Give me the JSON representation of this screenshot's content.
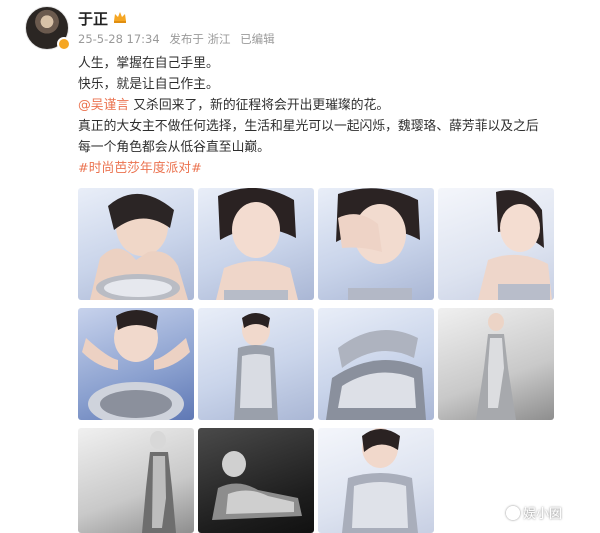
{
  "post": {
    "username": "于正",
    "badge_icon": "crown-icon",
    "verified_icon": "verified-badge-icon",
    "timestamp": "25-5-28 17:34",
    "source": "发布于 浙江",
    "edited": "已编辑",
    "lines": [
      "人生，掌握在自己手里。",
      "快乐，就是让自己作主。"
    ],
    "mention": "@吴谨言",
    "mention_tail": " 又杀回来了，新的征程将会开出更璀璨的花。",
    "line4": "真正的大女主不做任何选择，生活和星光可以一起闪烁，魏璎珞、薛芳菲以及之后",
    "line5": "每一个角色都会从低谷直至山巅。",
    "hashtag": "#时尚芭莎年度派对#"
  },
  "images": [
    {
      "name": "photo-1",
      "theme": "portrait hands on cheek, sequin dress"
    },
    {
      "name": "photo-2",
      "theme": "portrait chin on hand"
    },
    {
      "name": "photo-3",
      "theme": "portrait hand over face"
    },
    {
      "name": "photo-4",
      "theme": "portrait looking sideways"
    },
    {
      "name": "photo-5",
      "theme": "arms framing face"
    },
    {
      "name": "photo-6",
      "theme": "sequin dress pose"
    },
    {
      "name": "photo-7",
      "theme": "reclining in sequin dress"
    },
    {
      "name": "photo-8",
      "theme": "full length gown"
    },
    {
      "name": "photo-9",
      "theme": "black and white full length"
    },
    {
      "name": "photo-10",
      "theme": "black and white seated pose"
    },
    {
      "name": "photo-11",
      "theme": "half length sequin dress"
    }
  ],
  "watermark": "娱小囡",
  "colors": {
    "link": "#eb7350",
    "meta": "#9a9a9a",
    "badge": "#f5a623"
  }
}
